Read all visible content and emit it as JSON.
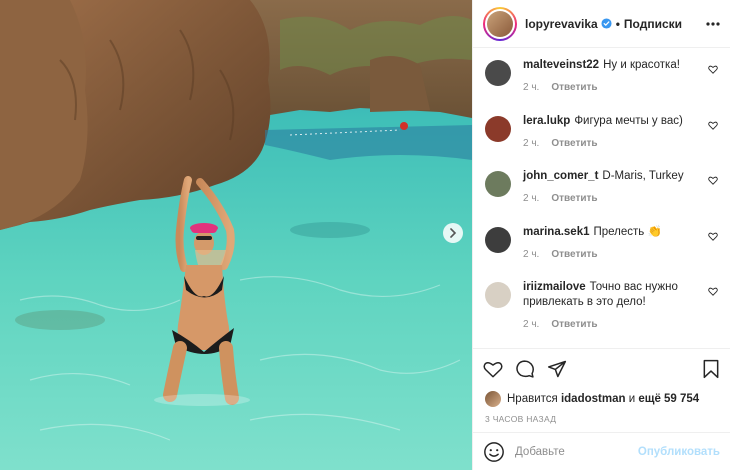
{
  "post": {
    "username": "lopyrevavika",
    "separator": "•",
    "follow_label": "Подписки",
    "verified_icon": "verified-badge-icon",
    "accent_verified": "#3897f0"
  },
  "comments": [
    {
      "user": "malteveinst22",
      "text": "Ну и красотка!",
      "time": "2 ч.",
      "reply": "Ответить",
      "avatar_color": "#4a4a4a"
    },
    {
      "user": "lera.lukp",
      "text": "Фигура мечты у вас)",
      "time": "2 ч.",
      "reply": "Ответить",
      "avatar_color": "#8b3a2a"
    },
    {
      "user": "john_comer_t",
      "text": "D-Maris, Turkey",
      "time": "2 ч.",
      "reply": "Ответить",
      "avatar_color": "#6d7b5e"
    },
    {
      "user": "marina.sek1",
      "text": "Прелесть",
      "emoji": "👏",
      "time": "2 ч.",
      "reply": "Ответить",
      "avatar_color": "#3d3d3d"
    },
    {
      "user": "iriizmailove",
      "text": "Точно вас нужно привлекать в это дело!",
      "time": "2 ч.",
      "reply": "Ответить",
      "avatar_color": "#d8d0c4"
    }
  ],
  "likes": {
    "prefix": "Нравится",
    "user": "idadostman",
    "middle": "и",
    "count_label": "ещё 59 754"
  },
  "timestamp": "3 ЧАСОВ НАЗАД",
  "comment_box": {
    "placeholder": "Добавьте",
    "publish_label": "Опубликовать",
    "publish_color": "#b2dffc"
  }
}
